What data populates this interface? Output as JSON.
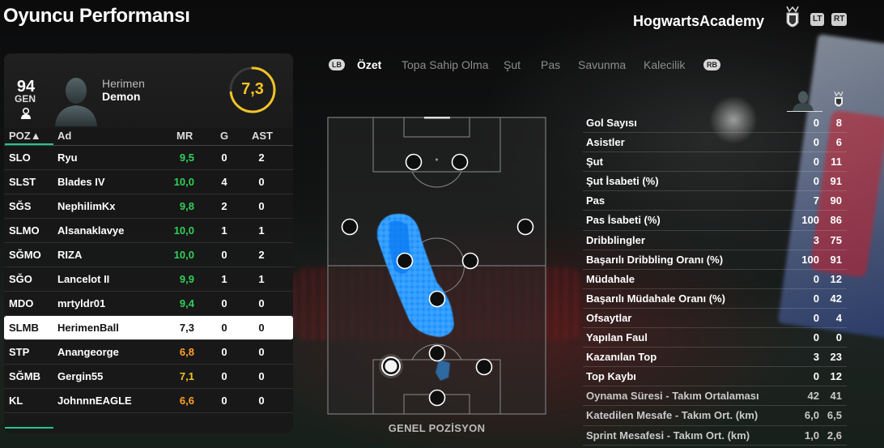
{
  "header": {
    "title": "Oyuncu Performansı",
    "club_name": "HogwartsAcademy",
    "lt_label": "LT",
    "rt_label": "RT"
  },
  "player": {
    "overall": "94",
    "overall_label": "GEN",
    "first_name": "Herimen",
    "last_name": "Demon",
    "rating": "7,3",
    "rating_fraction": 0.73
  },
  "table": {
    "headers": {
      "pos": "POZ▲",
      "name": "Ad",
      "mr": "MR",
      "g": "G",
      "ast": "AST"
    },
    "rows": [
      {
        "pos": "SLO",
        "name": "Ryu",
        "mr": "9,5",
        "g": "0",
        "ast": "2",
        "mr_color": "green"
      },
      {
        "pos": "SLST",
        "name": "Blades IV",
        "mr": "10,0",
        "g": "4",
        "ast": "0",
        "mr_color": "green"
      },
      {
        "pos": "SĞS",
        "name": "NephilimKx",
        "mr": "9,8",
        "g": "2",
        "ast": "0",
        "mr_color": "green"
      },
      {
        "pos": "SLMO",
        "name": "Alsanaklavye",
        "mr": "10,0",
        "g": "1",
        "ast": "1",
        "mr_color": "green"
      },
      {
        "pos": "SĞMO",
        "name": "RIZA",
        "mr": "10,0",
        "g": "0",
        "ast": "2",
        "mr_color": "green"
      },
      {
        "pos": "SĞO",
        "name": "Lancelot II",
        "mr": "9,9",
        "g": "1",
        "ast": "1",
        "mr_color": "green"
      },
      {
        "pos": "MDO",
        "name": "mrtyldr01",
        "mr": "9,4",
        "g": "0",
        "ast": "0",
        "mr_color": "green"
      },
      {
        "pos": "SLMB",
        "name": "HerimenBall",
        "mr": "7,3",
        "g": "0",
        "ast": "0",
        "mr_color": "selected"
      },
      {
        "pos": "STP",
        "name": "Anangeorge",
        "mr": "6,8",
        "g": "0",
        "ast": "0",
        "mr_color": "orange"
      },
      {
        "pos": "SĞMB",
        "name": "Gergin55",
        "mr": "7,1",
        "g": "0",
        "ast": "0",
        "mr_color": "yellow"
      },
      {
        "pos": "KL",
        "name": "JohnnnEAGLE",
        "mr": "6,6",
        "g": "0",
        "ast": "0",
        "mr_color": "orange"
      }
    ],
    "selected_index": 7
  },
  "tabs": {
    "left_chip": "LB",
    "right_chip": "RB",
    "items": [
      "Özet",
      "Topa Sahip Olma",
      "Şut",
      "Pas",
      "Savunma",
      "Kalecilik"
    ],
    "active_index": 0
  },
  "pitch": {
    "label": "GENEL POZİSYON"
  },
  "stats": {
    "rows": [
      {
        "label": "Gol Sayısı",
        "player": "0",
        "team": "8"
      },
      {
        "label": "Asistler",
        "player": "0",
        "team": "6"
      },
      {
        "label": "Şut",
        "player": "0",
        "team": "11"
      },
      {
        "label": "Şut İsabeti (%)",
        "player": "0",
        "team": "91"
      },
      {
        "label": "Pas",
        "player": "7",
        "team": "90"
      },
      {
        "label": "Pas İsabeti (%)",
        "player": "100",
        "team": "86"
      },
      {
        "label": "Dribblingler",
        "player": "3",
        "team": "75"
      },
      {
        "label": "Başarılı Dribbling Oranı (%)",
        "player": "100",
        "team": "91"
      },
      {
        "label": "Müdahale",
        "player": "0",
        "team": "12"
      },
      {
        "label": "Başarılı Müdahale Oranı (%)",
        "player": "0",
        "team": "42"
      },
      {
        "label": "Ofsaytlar",
        "player": "0",
        "team": "4"
      },
      {
        "label": "Yapılan Faul",
        "player": "0",
        "team": "0"
      },
      {
        "label": "Kazanılan Top",
        "player": "3",
        "team": "23"
      },
      {
        "label": "Top Kaybı",
        "player": "0",
        "team": "12"
      },
      {
        "label": "Oynama Süresi - Takım Ortalaması",
        "player": "42",
        "team": "41"
      },
      {
        "label": "Katedilen Mesafe - Takım Ort. (km)",
        "player": "6,0",
        "team": "6,5"
      },
      {
        "label": "Sprint Mesafesi - Takım Ort. (km)",
        "player": "1,0",
        "team": "2,6"
      }
    ]
  },
  "colors": {
    "green": "#30d158",
    "orange": "#ff9f2a",
    "yellow": "#f3c326",
    "heatmap": "#1e90ff",
    "accent": "#1ec98b"
  },
  "icons": {
    "crest": "hogwarts-crest-icon",
    "person": "person-icon",
    "avatar": "player-avatar"
  }
}
